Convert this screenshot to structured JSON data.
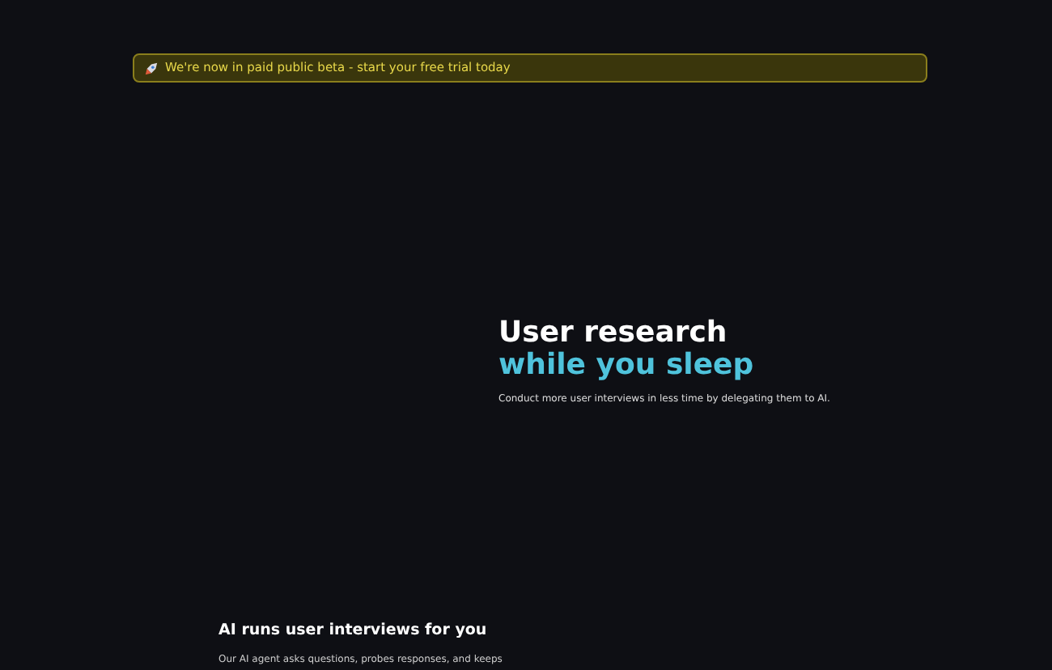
{
  "banner": {
    "text": "We're now in paid public beta - start your free trial today"
  },
  "hero": {
    "title_line_1": "User research",
    "title_line_2": "while you sleep",
    "subtitle": "Conduct more user interviews in less time by delegating them to AI."
  },
  "section": {
    "heading": "AI runs user interviews for you",
    "body": "Our AI agent asks questions, probes responses, and keeps"
  }
}
